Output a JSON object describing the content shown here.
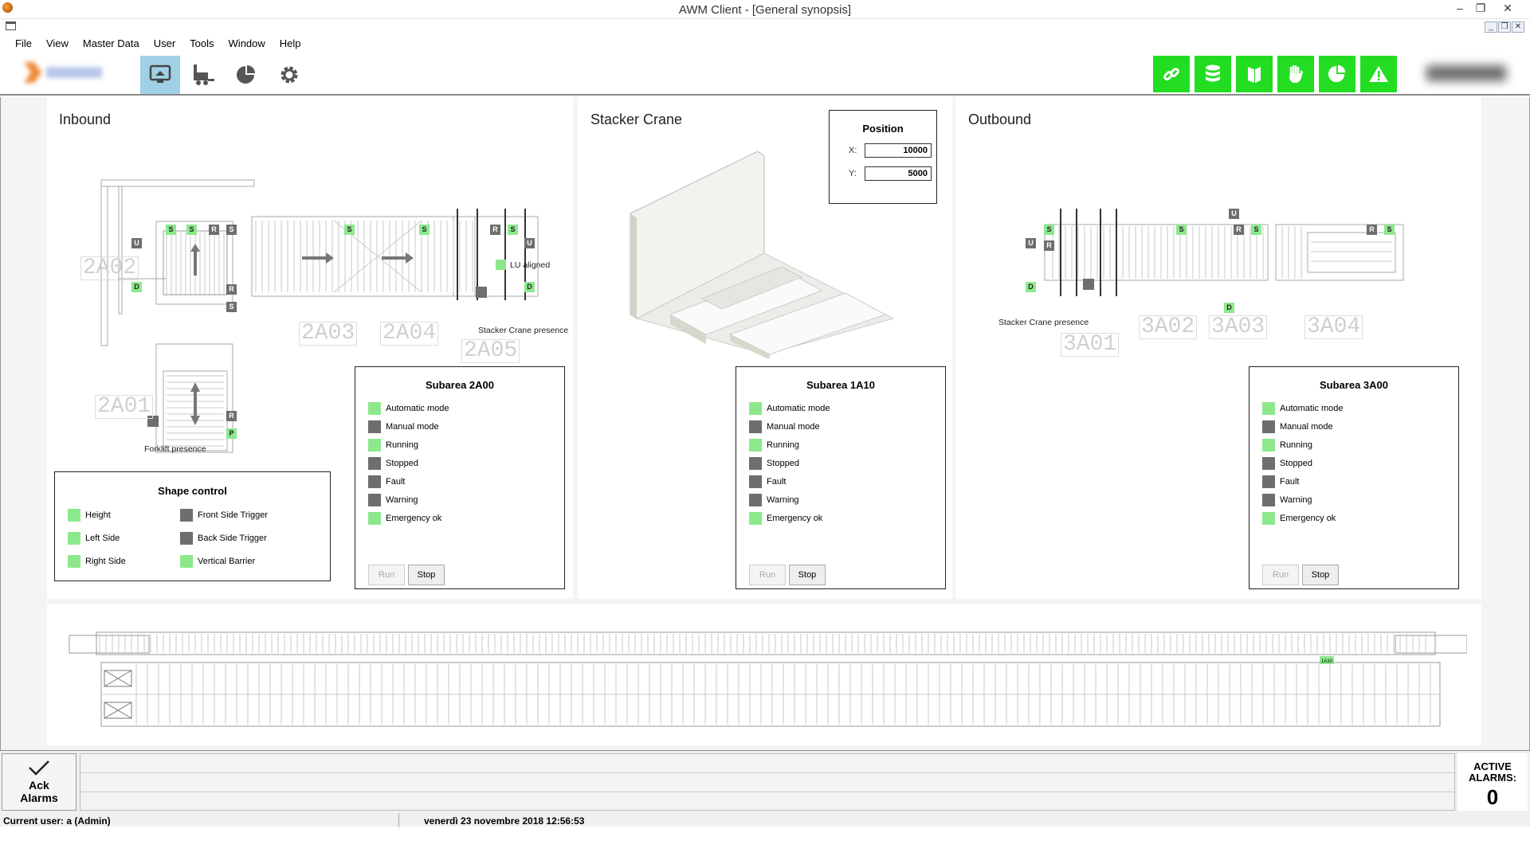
{
  "window": {
    "title": "AWM Client - [General synopsis]"
  },
  "menu": [
    "File",
    "View",
    "Master Data",
    "User",
    "Tools",
    "Window",
    "Help"
  ],
  "toolbar": {
    "left_buttons": [
      {
        "name": "synopsis-monitor-icon",
        "active": true
      },
      {
        "name": "forklift-icon",
        "active": false
      },
      {
        "name": "pie-chart-icon",
        "active": false
      },
      {
        "name": "gear-icon",
        "active": false
      }
    ],
    "status_buttons": [
      "link-icon",
      "database-icon",
      "book-icon",
      "hand-icon",
      "pie-chart-icon",
      "warning-icon"
    ],
    "status_color": "#22dd22"
  },
  "inbound": {
    "title": "Inbound",
    "labels": {
      "forklift_presence": "Forklift presence",
      "lu_aligned": "LU aligned",
      "stacker_crane_presence": "Stacker Crane presence"
    },
    "areas": [
      "2A02",
      "2A03",
      "2A04",
      "2A05",
      "2A01"
    ],
    "shape_control": {
      "title": "Shape control",
      "left": [
        {
          "label": "Height",
          "state": "green"
        },
        {
          "label": "Left Side",
          "state": "green"
        },
        {
          "label": "Right Side",
          "state": "green"
        }
      ],
      "right": [
        {
          "label": "Front Side Trigger",
          "state": "gray"
        },
        {
          "label": "Back Side Trigger",
          "state": "gray"
        },
        {
          "label": "Vertical Barrier",
          "state": "green"
        }
      ]
    }
  },
  "stacker": {
    "title": "Stacker Crane",
    "position": {
      "title": "Position",
      "x_label": "X:",
      "x": "10000",
      "y_label": "Y:",
      "y": "5000"
    }
  },
  "outbound": {
    "title": "Outbound",
    "labels": {
      "stacker_crane_presence": "Stacker Crane presence"
    },
    "areas": [
      "3A02",
      "3A03",
      "3A04",
      "3A01"
    ]
  },
  "subareas": [
    {
      "title": "Subarea 2A00",
      "rows": [
        {
          "label": "Automatic mode",
          "state": "green"
        },
        {
          "label": "Manual mode",
          "state": "gray"
        },
        {
          "label": "Running",
          "state": "green"
        },
        {
          "label": "Stopped",
          "state": "gray"
        },
        {
          "label": "Fault",
          "state": "gray"
        },
        {
          "label": "Warning",
          "state": "gray"
        },
        {
          "label": "Emergency ok",
          "state": "green"
        }
      ],
      "run": "Run",
      "stop": "Stop"
    },
    {
      "title": "Subarea 1A10",
      "rows": [
        {
          "label": "Automatic mode",
          "state": "green"
        },
        {
          "label": "Manual mode",
          "state": "gray"
        },
        {
          "label": "Running",
          "state": "green"
        },
        {
          "label": "Stopped",
          "state": "gray"
        },
        {
          "label": "Fault",
          "state": "gray"
        },
        {
          "label": "Warning",
          "state": "gray"
        },
        {
          "label": "Emergency ok",
          "state": "green"
        }
      ],
      "run": "Run",
      "stop": "Stop"
    },
    {
      "title": "Subarea 3A00",
      "rows": [
        {
          "label": "Automatic mode",
          "state": "green"
        },
        {
          "label": "Manual mode",
          "state": "gray"
        },
        {
          "label": "Running",
          "state": "green"
        },
        {
          "label": "Stopped",
          "state": "gray"
        },
        {
          "label": "Fault",
          "state": "gray"
        },
        {
          "label": "Warning",
          "state": "gray"
        },
        {
          "label": "Emergency ok",
          "state": "green"
        }
      ],
      "run": "Run",
      "stop": "Stop"
    }
  ],
  "overview": {
    "marker": "1A10"
  },
  "footer": {
    "ack_line1": "Ack",
    "ack_line2": "Alarms",
    "active_alarms_label1": "ACTIVE",
    "active_alarms_label2": "ALARMS:",
    "active_alarms_count": "0",
    "current_user": "Current user: a (Admin)",
    "datetime": "venerdì 23 novembre 2018 12:56:53"
  }
}
